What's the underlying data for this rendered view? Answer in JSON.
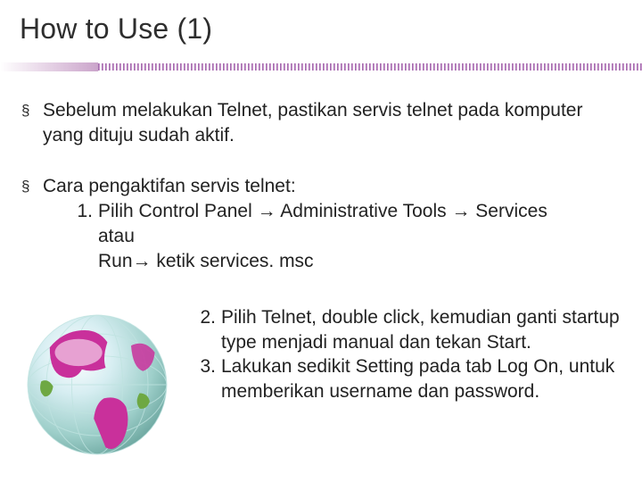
{
  "title": "How to Use (1)",
  "arrow": "→",
  "bullets": [
    {
      "text": "Sebelum melakukan Telnet, pastikan servis telnet pada komputer yang dituju sudah aktif."
    },
    {
      "text": "Cara pengaktifan servis telnet:",
      "steps_a": {
        "num1": "1.",
        "s1a": "Pilih Control Panel ",
        "s1b": " Administrative Tools ",
        "s1c": " Services",
        "s1d": "atau",
        "s1e": "Run",
        "s1f": " ketik services. msc"
      },
      "steps_b": [
        {
          "num": "2.",
          "text": "Pilih Telnet, double click, kemudian ganti startup type menjadi manual dan tekan Start."
        },
        {
          "num": "3.",
          "text": "Lakukan sedikit Setting pada tab Log On, untuk memberikan username dan password."
        }
      ]
    }
  ]
}
